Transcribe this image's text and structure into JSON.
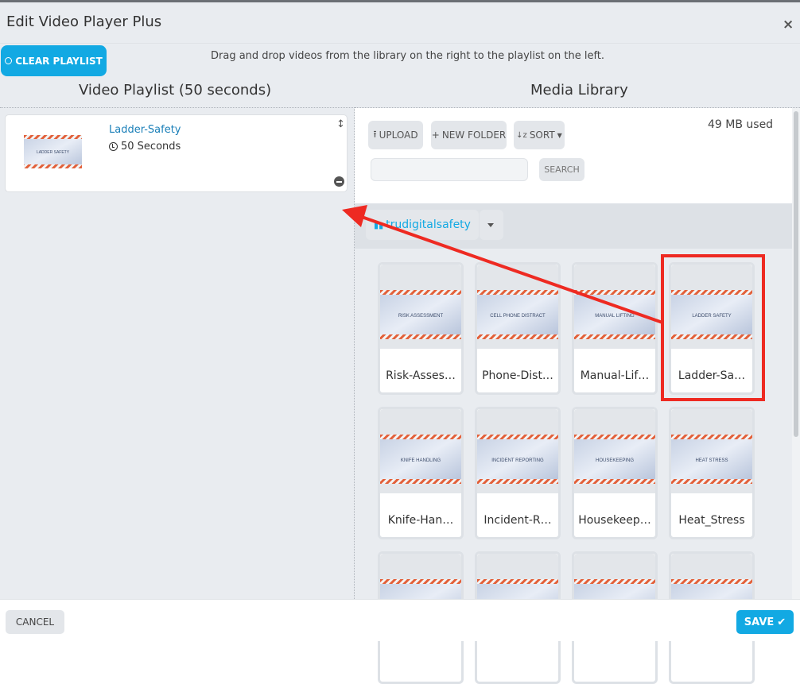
{
  "dialog": {
    "title": "Edit Video Player Plus",
    "close_icon": "close-icon"
  },
  "toolbar": {
    "clear_label": "CLEAR PLAYLIST",
    "instructions": "Drag and drop videos from the library on the right to the playlist on the left."
  },
  "playlist": {
    "heading": "Video Playlist (50 seconds)",
    "items": [
      {
        "name": "Ladder-Safety",
        "duration": "50 Seconds",
        "thumb_text": "LADDER SAFETY"
      }
    ]
  },
  "library": {
    "heading": "Media Library",
    "upload_label": "UPLOAD",
    "new_folder_label": "NEW FOLDER",
    "sort_label": "SORT",
    "usage": "49 MB used",
    "search_placeholder": "",
    "search_label": "SEARCH",
    "folder": "trudigitalsafety",
    "items": [
      {
        "label": "Risk-Asses…",
        "thumb_text": "RISK ASSESSMENT"
      },
      {
        "label": "Phone-Dist…",
        "thumb_text": "CELL PHONE DISTRACT"
      },
      {
        "label": "Manual-Lif…",
        "thumb_text": "MANUAL LIFTING"
      },
      {
        "label": "Ladder-Sa…",
        "thumb_text": "LADDER SAFETY"
      },
      {
        "label": "Knife-Han…",
        "thumb_text": "KNIFE HANDLING"
      },
      {
        "label": "Incident-R…",
        "thumb_text": "INCIDENT REPORTING"
      },
      {
        "label": "Housekeep…",
        "thumb_text": "HOUSEKEEPING"
      },
      {
        "label": "Heat_Stress",
        "thumb_text": "HEAT STRESS"
      },
      {
        "label": "",
        "thumb_text": ""
      },
      {
        "label": "",
        "thumb_text": ""
      },
      {
        "label": "",
        "thumb_text": ""
      },
      {
        "label": "",
        "thumb_text": ""
      }
    ]
  },
  "footer": {
    "cancel_label": "CANCEL",
    "save_label": "SAVE"
  },
  "colors": {
    "accent": "#12a9e3",
    "annotation": "#ee2a22",
    "panel": "#e9ecf0"
  }
}
